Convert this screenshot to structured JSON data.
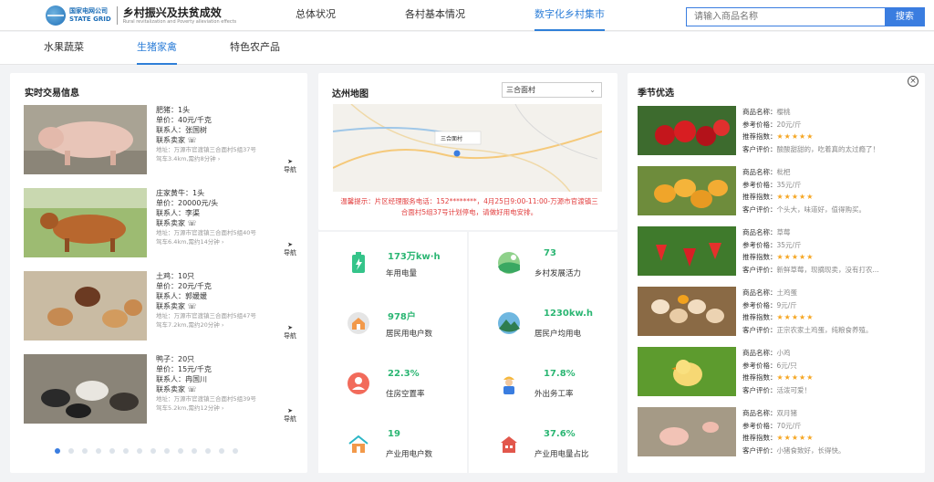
{
  "brand": {
    "company": "国家电网公司",
    "company_en": "STATE GRID",
    "title": "乡村振兴及扶贫成效",
    "subtitle": "Rural revitalization and Poverty alleviation effects"
  },
  "nav": {
    "items": [
      {
        "label": "总体状况",
        "active": false
      },
      {
        "label": "各村基本情况",
        "active": false
      },
      {
        "label": "数字化乡村集市",
        "active": true
      }
    ]
  },
  "subnav": {
    "tabs": [
      {
        "label": "水果蔬菜",
        "active": false
      },
      {
        "label": "生猪家禽",
        "active": true
      },
      {
        "label": "特色农产品",
        "active": false
      }
    ]
  },
  "search": {
    "placeholder": "请输入商品名称",
    "button": "搜索"
  },
  "trade": {
    "title": "实时交易信息",
    "contact_label": "联系卖家",
    "nav_label": "导航",
    "items": [
      {
        "name": "肥猪：1头",
        "price": "单价：40元/千克",
        "contact": "联系人：张国树",
        "address": "地址：万源市官渡镇三合面村5组37号",
        "route": "驾车3.4km,需约8分钟",
        "image": "pig"
      },
      {
        "name": "庄家黄牛：1头",
        "price": "单价：20000元/头",
        "contact": "联系人：李渠",
        "address": "地址：万源市官渡镇三合面村5组40号",
        "route": "驾车6.4km,需约14分钟",
        "image": "cow"
      },
      {
        "name": "土鸡：10只",
        "price": "单价：20元/千克",
        "contact": "联系人：郭媛媛",
        "address": "地址：万源市官渡镇三合面村5组47号",
        "route": "驾车7.2km,需约20分钟",
        "image": "chicken"
      },
      {
        "name": "鸭子：20只",
        "price": "单价：15元/千克",
        "contact": "联系人：冉国川",
        "address": "地址：万源市官渡镇三合面村5组39号",
        "route": "驾车5.2km,需约12分钟",
        "image": "duck"
      }
    ],
    "pages": 14,
    "current_page": 1
  },
  "map": {
    "title": "达州地图",
    "select_value": "三合面村",
    "pin_label": "三合面村",
    "notice": "温馨提示：片区经理服务电话：152********，4月25日9:00-11:00-万源市官渡镇三合面村5组37号计划停电，请做好用电安排。"
  },
  "stats": [
    {
      "value": "173万kw·h",
      "label": "年用电量",
      "icon": "battery-icon"
    },
    {
      "value": "73",
      "label": "乡村发展活力",
      "icon": "landscape-icon"
    },
    {
      "value": "978户",
      "label": "居民用电户数",
      "icon": "house-icon"
    },
    {
      "value": "1230kw.h",
      "label": "居民户均用电",
      "icon": "mountain-icon"
    },
    {
      "value": "22.3%",
      "label": "住房空置率",
      "icon": "person-icon"
    },
    {
      "value": "17.8%",
      "label": "外出务工率",
      "icon": "worker-icon"
    },
    {
      "value": "19",
      "label": "产业用电户数",
      "icon": "factory-house-icon"
    },
    {
      "value": "37.6%",
      "label": "产业用电量占比",
      "icon": "building-icon"
    }
  ],
  "season": {
    "title": "季节优选",
    "labels": {
      "name": "商品名称：",
      "price": "参考价格：",
      "rec": "推荐指数：",
      "review": "客户评价："
    },
    "items": [
      {
        "name": "樱桃",
        "price": "20元/斤",
        "review": "酸酸甜甜的，吃着真的太过瘾了！",
        "image": "cherry",
        "stars": 5
      },
      {
        "name": "枇杷",
        "price": "35元/斤",
        "review": "个头大，味道好，值得购买。",
        "image": "loquat",
        "stars": 5
      },
      {
        "name": "草莓",
        "price": "35元/斤",
        "review": "新鲜草莓，现摘现卖，没有打农...",
        "image": "strawberry",
        "stars": 5
      },
      {
        "name": "土鸡蛋",
        "price": "9元/斤",
        "review": "正宗农家土鸡蛋，纯粮食养殖。",
        "image": "egg",
        "stars": 5
      },
      {
        "name": "小鸡",
        "price": "6元/只",
        "review": "活泼可爱！",
        "image": "chick",
        "stars": 5
      },
      {
        "name": "双月猪",
        "price": "70元/斤",
        "review": "小猪食致好，长得快。",
        "image": "piglet",
        "stars": 5
      }
    ]
  },
  "colors": {
    "accent": "#2f7fd8",
    "green": "#2bb673",
    "red": "#e23d3d",
    "star": "#f5a623"
  }
}
